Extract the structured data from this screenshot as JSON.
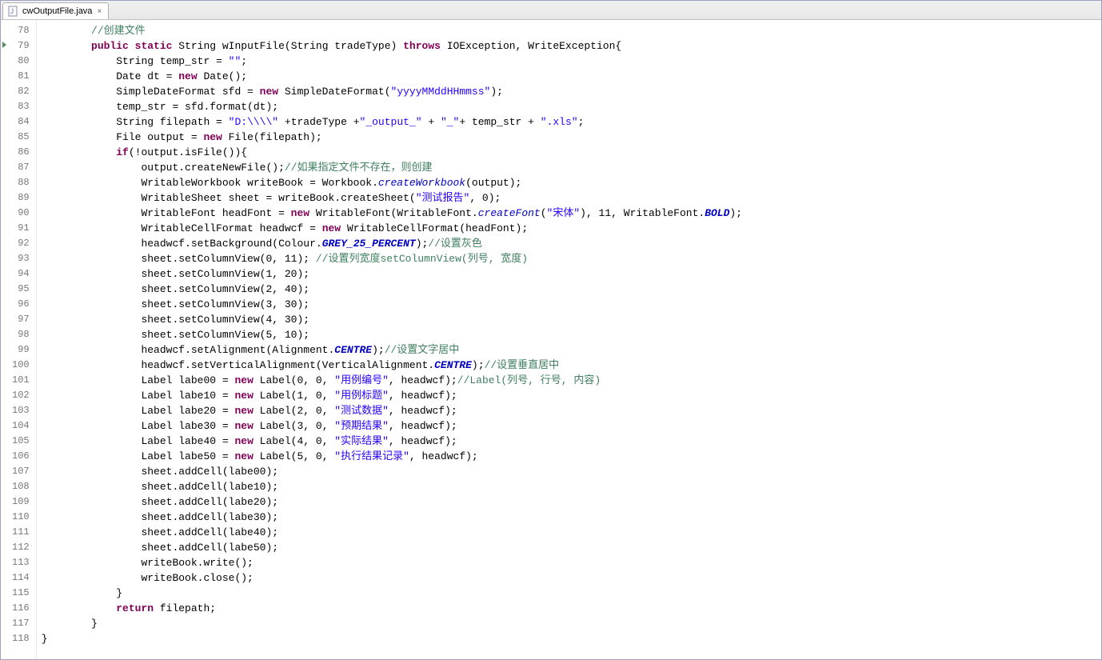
{
  "tab": {
    "filename": "cwOutputFile.java",
    "icon": "java-file-icon",
    "close": "×"
  },
  "first_line": 78,
  "override_line": 79,
  "lines": [
    {
      "i": "        ",
      "t": [
        {
          "c": "cm",
          "v": "//创建文件"
        }
      ]
    },
    {
      "i": "        ",
      "t": [
        {
          "c": "kw",
          "v": "public"
        },
        {
          "v": " "
        },
        {
          "c": "kw",
          "v": "static"
        },
        {
          "v": " String wInputFile(String tradeType) "
        },
        {
          "c": "kw",
          "v": "throws"
        },
        {
          "v": " IOException, WriteException{"
        }
      ]
    },
    {
      "i": "            ",
      "t": [
        {
          "v": "String temp_str = "
        },
        {
          "c": "st",
          "v": "\"\""
        },
        {
          "v": ";"
        }
      ]
    },
    {
      "i": "            ",
      "t": [
        {
          "v": "Date dt = "
        },
        {
          "c": "kw",
          "v": "new"
        },
        {
          "v": " Date();"
        }
      ]
    },
    {
      "i": "            ",
      "t": [
        {
          "v": "SimpleDateFormat sfd = "
        },
        {
          "c": "kw",
          "v": "new"
        },
        {
          "v": " SimpleDateFormat("
        },
        {
          "c": "st",
          "v": "\"yyyyMMddHHmmss\""
        },
        {
          "v": ");"
        }
      ]
    },
    {
      "i": "            ",
      "t": [
        {
          "v": "temp_str = sfd.format(dt);"
        }
      ]
    },
    {
      "i": "            ",
      "t": [
        {
          "v": "String filepath = "
        },
        {
          "c": "st",
          "v": "\"D:\\\\\\\\\""
        },
        {
          "v": " +tradeType +"
        },
        {
          "c": "st",
          "v": "\"_output_\""
        },
        {
          "v": " + "
        },
        {
          "c": "st",
          "v": "\"_\""
        },
        {
          "v": "+ temp_str + "
        },
        {
          "c": "st",
          "v": "\".xls\""
        },
        {
          "v": ";"
        }
      ]
    },
    {
      "i": "            ",
      "t": [
        {
          "v": "File output = "
        },
        {
          "c": "kw",
          "v": "new"
        },
        {
          "v": " File(filepath);"
        }
      ]
    },
    {
      "i": "            ",
      "t": [
        {
          "c": "kw",
          "v": "if"
        },
        {
          "v": "(!output.isFile()){"
        }
      ]
    },
    {
      "i": "                ",
      "t": [
        {
          "v": "output.createNewFile();"
        },
        {
          "c": "cm",
          "v": "//如果指定文件不存在，则创建"
        }
      ]
    },
    {
      "i": "                ",
      "t": [
        {
          "v": "WritableWorkbook writeBook = Workbook."
        },
        {
          "c": "stat",
          "v": "createWorkbook"
        },
        {
          "v": "(output);"
        }
      ]
    },
    {
      "i": "                ",
      "t": [
        {
          "v": "WritableSheet sheet = writeBook.createSheet("
        },
        {
          "c": "st",
          "v": "\"测试报告\""
        },
        {
          "v": ", 0);"
        }
      ]
    },
    {
      "i": "                ",
      "t": [
        {
          "v": "WritableFont headFont = "
        },
        {
          "c": "kw",
          "v": "new"
        },
        {
          "v": " WritableFont(WritableFont."
        },
        {
          "c": "stat",
          "v": "createFont"
        },
        {
          "v": "("
        },
        {
          "c": "st",
          "v": "\"宋体\""
        },
        {
          "v": "), 11, WritableFont."
        },
        {
          "c": "statb",
          "v": "BOLD"
        },
        {
          "v": ");"
        }
      ]
    },
    {
      "i": "                ",
      "t": [
        {
          "v": "WritableCellFormat headwcf = "
        },
        {
          "c": "kw",
          "v": "new"
        },
        {
          "v": " WritableCellFormat(headFont);"
        }
      ]
    },
    {
      "i": "                ",
      "t": [
        {
          "v": "headwcf.setBackground(Colour."
        },
        {
          "c": "statb",
          "v": "GREY_25_PERCENT"
        },
        {
          "v": ");"
        },
        {
          "c": "cm",
          "v": "//设置灰色"
        }
      ]
    },
    {
      "i": "                ",
      "t": [
        {
          "v": "sheet.setColumnView(0, 11); "
        },
        {
          "c": "cm",
          "v": "//设置列宽度setColumnView(列号, 宽度)"
        }
      ]
    },
    {
      "i": "                ",
      "t": [
        {
          "v": "sheet.setColumnView(1, 20);"
        }
      ]
    },
    {
      "i": "                ",
      "t": [
        {
          "v": "sheet.setColumnView(2, 40);"
        }
      ]
    },
    {
      "i": "                ",
      "t": [
        {
          "v": "sheet.setColumnView(3, 30);"
        }
      ]
    },
    {
      "i": "                ",
      "t": [
        {
          "v": "sheet.setColumnView(4, 30);"
        }
      ]
    },
    {
      "i": "                ",
      "t": [
        {
          "v": "sheet.setColumnView(5, 10);"
        }
      ]
    },
    {
      "i": "                ",
      "t": [
        {
          "v": "headwcf.setAlignment(Alignment."
        },
        {
          "c": "statb",
          "v": "CENTRE"
        },
        {
          "v": ");"
        },
        {
          "c": "cm",
          "v": "//设置文字居中"
        }
      ]
    },
    {
      "i": "                ",
      "t": [
        {
          "v": "headwcf.setVerticalAlignment(VerticalAlignment."
        },
        {
          "c": "statb",
          "v": "CENTRE"
        },
        {
          "v": ");"
        },
        {
          "c": "cm",
          "v": "//设置垂直居中"
        }
      ]
    },
    {
      "i": "                ",
      "t": [
        {
          "v": "Label labe00 = "
        },
        {
          "c": "kw",
          "v": "new"
        },
        {
          "v": " Label(0, 0, "
        },
        {
          "c": "st",
          "v": "\"用例编号\""
        },
        {
          "v": ", headwcf);"
        },
        {
          "c": "cm",
          "v": "//Label(列号, 行号, 内容)"
        }
      ]
    },
    {
      "i": "                ",
      "t": [
        {
          "v": "Label labe10 = "
        },
        {
          "c": "kw",
          "v": "new"
        },
        {
          "v": " Label(1, 0, "
        },
        {
          "c": "st",
          "v": "\"用例标题\""
        },
        {
          "v": ", headwcf);"
        }
      ]
    },
    {
      "i": "                ",
      "t": [
        {
          "v": "Label labe20 = "
        },
        {
          "c": "kw",
          "v": "new"
        },
        {
          "v": " Label(2, 0, "
        },
        {
          "c": "st",
          "v": "\"测试数据\""
        },
        {
          "v": ", headwcf);"
        }
      ]
    },
    {
      "i": "                ",
      "t": [
        {
          "v": "Label labe30 = "
        },
        {
          "c": "kw",
          "v": "new"
        },
        {
          "v": " Label(3, 0, "
        },
        {
          "c": "st",
          "v": "\"预期结果\""
        },
        {
          "v": ", headwcf);"
        }
      ]
    },
    {
      "i": "                ",
      "t": [
        {
          "v": "Label labe40 = "
        },
        {
          "c": "kw",
          "v": "new"
        },
        {
          "v": " Label(4, 0, "
        },
        {
          "c": "st",
          "v": "\"实际结果\""
        },
        {
          "v": ", headwcf);"
        }
      ]
    },
    {
      "i": "                ",
      "t": [
        {
          "v": "Label labe50 = "
        },
        {
          "c": "kw",
          "v": "new"
        },
        {
          "v": " Label(5, 0, "
        },
        {
          "c": "st",
          "v": "\"执行结果记录\""
        },
        {
          "v": ", headwcf);"
        }
      ]
    },
    {
      "i": "                ",
      "t": [
        {
          "v": "sheet.addCell(labe00);"
        }
      ]
    },
    {
      "i": "                ",
      "t": [
        {
          "v": "sheet.addCell(labe10);"
        }
      ]
    },
    {
      "i": "                ",
      "t": [
        {
          "v": "sheet.addCell(labe20);"
        }
      ]
    },
    {
      "i": "                ",
      "t": [
        {
          "v": "sheet.addCell(labe30);"
        }
      ]
    },
    {
      "i": "                ",
      "t": [
        {
          "v": "sheet.addCell(labe40);"
        }
      ]
    },
    {
      "i": "                ",
      "t": [
        {
          "v": "sheet.addCell(labe50);"
        }
      ]
    },
    {
      "i": "                ",
      "t": [
        {
          "v": "writeBook.write();"
        }
      ]
    },
    {
      "i": "                ",
      "t": [
        {
          "v": "writeBook.close();"
        }
      ]
    },
    {
      "i": "            ",
      "t": [
        {
          "v": "}"
        }
      ]
    },
    {
      "i": "            ",
      "t": [
        {
          "c": "kw",
          "v": "return"
        },
        {
          "v": " filepath;"
        }
      ]
    },
    {
      "i": "        ",
      "t": [
        {
          "v": "}"
        }
      ]
    },
    {
      "i": "",
      "t": [
        {
          "v": "}"
        }
      ]
    }
  ]
}
